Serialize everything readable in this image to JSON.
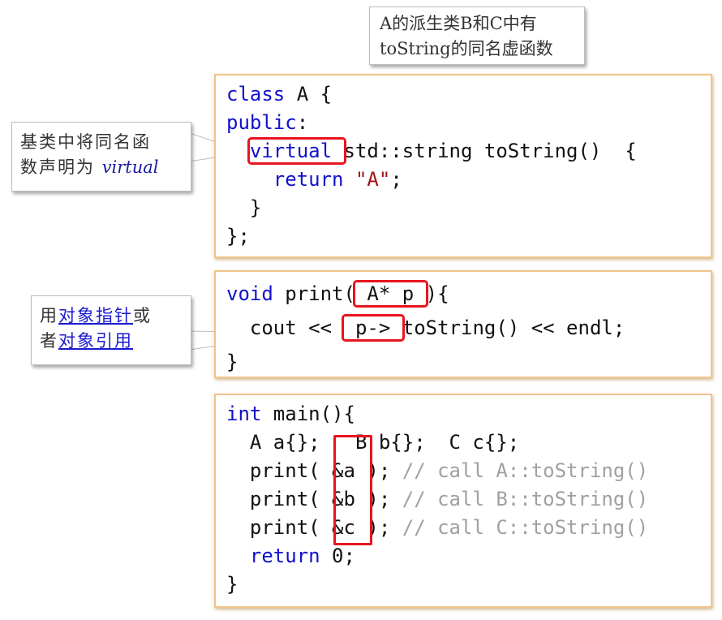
{
  "title_note": {
    "line1": "A的派生类B和C中有",
    "line2": "toString的同名虚函数"
  },
  "callout_virtual": {
    "line1": "基类中将同名函",
    "line2_prefix": "数声明为 ",
    "line2_em": "virtual"
  },
  "callout_pointer": {
    "line1_prefix": "用",
    "line1_link": "对象指针",
    "line1_suffix": "或",
    "line2_prefix": "者",
    "line2_link": "对象引用"
  },
  "code_class": {
    "l1_kw": "class",
    "l1_rest": " A {",
    "l2_kw": "public",
    "l2_rest": ":",
    "l3_indent": "  ",
    "l3_hl": "virtual ",
    "l3_rest": "std::string toString()  {",
    "l4_indent": "    ",
    "l4_kw": "return",
    "l4_sp": " ",
    "l4_str": "\"A\"",
    "l4_rest": ";",
    "l5": "  }",
    "l6": "};"
  },
  "code_print": {
    "l1_kw": "void",
    "l1_mid": " print(",
    "l1_hl": " A* p ",
    "l1_rest": "){",
    "l2_pre": "  cout << ",
    "l2_hl": " p-> ",
    "l2_rest": "toString() << endl;",
    "l3": "}"
  },
  "code_main": {
    "l1_kw": "int",
    "l1_rest": " main(){",
    "l2": "  A a{};   B b{};  C c{};",
    "calls": [
      {
        "pre": "  print( ",
        "arg": "&a",
        "post": " ); ",
        "comment": "// call A::toString()"
      },
      {
        "pre": "  print( ",
        "arg": "&b",
        "post": " ); ",
        "comment": "// call B::toString()"
      },
      {
        "pre": "  print( ",
        "arg": "&c",
        "post": " ); ",
        "comment": "// call C::toString()"
      }
    ],
    "ret_indent": "  ",
    "ret_kw": "return",
    "ret_rest": " 0;",
    "close": "}"
  },
  "colors": {
    "keyword": "#1111cc",
    "string": "#a31515",
    "comment": "#a0a0a0",
    "highlight": "#e8141e",
    "box_border": "#f0c48c"
  }
}
